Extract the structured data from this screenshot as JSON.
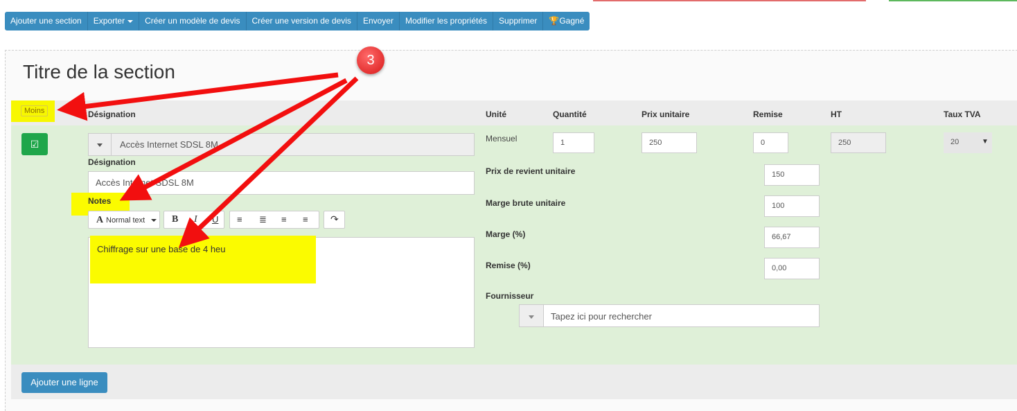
{
  "toolbar": {
    "add_section": "Ajouter une section",
    "export": "Exporter",
    "create_template": "Créer un modèle de devis",
    "create_version": "Créer une version de devis",
    "send": "Envoyer",
    "edit_properties": "Modifier les propriétés",
    "delete": "Supprimer",
    "won": "Gagné"
  },
  "section": {
    "title": "Titre de la section",
    "toggle_label": "Moins"
  },
  "table_headers": {
    "designation": "Désignation",
    "unit": "Unité",
    "quantity": "Quantité",
    "unit_price": "Prix unitaire",
    "discount": "Remise",
    "ht": "HT",
    "vat_rate": "Taux TVA"
  },
  "line": {
    "product_select": "Accès Internet SDSL 8M",
    "designation_label": "Désignation",
    "designation_value": "Accès Internet SDSL 8M",
    "notes_label": "Notes",
    "notes_text": "Chiffrage sur une base de 4 heu",
    "unit": "Mensuel",
    "quantity": "1",
    "unit_price": "250",
    "discount": "0",
    "ht": "250",
    "vat": "20"
  },
  "editor_toolbar": {
    "text_style": "Normal text",
    "bold": "B",
    "italic": "I",
    "underline": "U"
  },
  "details": {
    "cost_price_label": "Prix de revient unitaire",
    "cost_price": "150",
    "gross_margin_label": "Marge brute unitaire",
    "gross_margin": "100",
    "margin_pct_label": "Marge (%)",
    "margin_pct": "66,67",
    "discount_pct_label": "Remise (%)",
    "discount_pct": "0,00",
    "supplier_label": "Fournisseur",
    "supplier_placeholder": "Tapez ici pour rechercher"
  },
  "add_line": "Ajouter une ligne",
  "annotation": {
    "step_number": "3",
    "arrow_color": "#f20f0f",
    "highlight_color": "#f7f700"
  }
}
